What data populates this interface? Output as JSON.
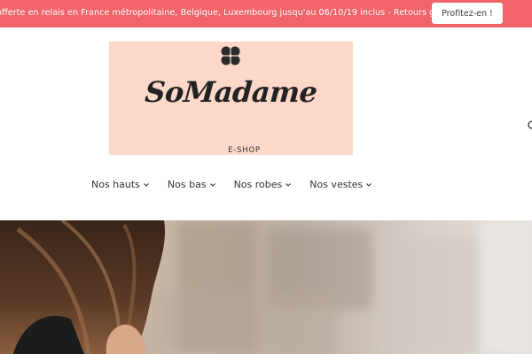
{
  "promo": {
    "text": "offerte en relais en France métropolitaine, Belgique, Luxembourg jusqu'au 06/10/19 inclus - Retours gratuits",
    "button_label": "Profitez-en !"
  },
  "brand": {
    "name": "SoMadame",
    "tagline": "E-SHOP",
    "icon": "clover-icon"
  },
  "nav": {
    "items": [
      {
        "label": "Nos hauts"
      },
      {
        "label": "Nos bas"
      },
      {
        "label": "Nos robes"
      },
      {
        "label": "Nos vestes"
      }
    ]
  },
  "colors": {
    "promo_bg": "#f0646a",
    "logo_bg": "#fdd8c8",
    "nav_text": "#333333"
  }
}
